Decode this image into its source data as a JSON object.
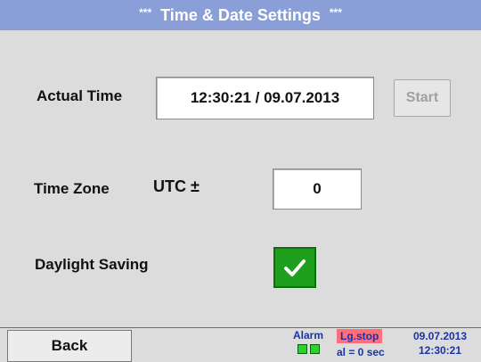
{
  "title": "Time & Date Settings",
  "title_decoration": "***",
  "actual_time": {
    "label": "Actual Time",
    "value": "12:30:21 / 09.07.2013",
    "start_label": "Start"
  },
  "time_zone": {
    "label": "Time Zone",
    "unit": "UTC ±",
    "value": "0"
  },
  "daylight_saving": {
    "label": "Daylight Saving",
    "checked": true
  },
  "footer": {
    "back_label": "Back",
    "alarm_label": "Alarm",
    "log_status": "Lg.stop",
    "log_interval": "al = 0 sec",
    "date": "09.07.2013",
    "time": "12:30:21"
  },
  "colors": {
    "title_bar": "#8a9ed8",
    "background": "#dcdcdc",
    "checkbox_green": "#1ea01e",
    "status_text": "#1a33a8",
    "log_stop_bg": "#ff6e7a"
  },
  "icons": {
    "checkbox": "checkmark-icon",
    "alarm_leds": "led-indicator-icon"
  }
}
